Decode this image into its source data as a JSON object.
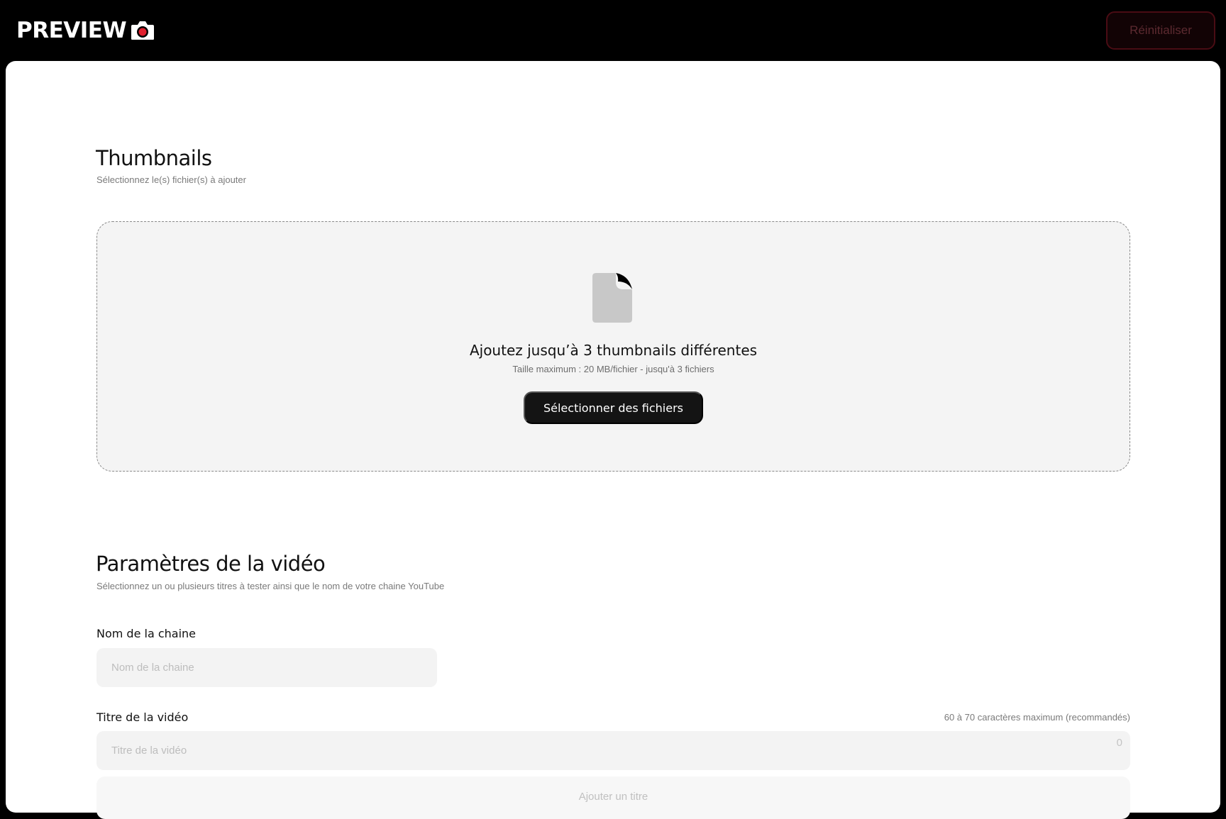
{
  "header": {
    "logo_text": "PREVIEW",
    "logo_icon": "camera-icon",
    "reset_label": "Réinitialiser",
    "accent_color": "#e0202e"
  },
  "thumbnails": {
    "title": "Thumbnails",
    "subtitle": "Sélectionnez le(s) fichier(s) à ajouter",
    "dropzone": {
      "icon": "file-icon",
      "title": "Ajoutez jusqu’à 3 thumbnails différentes",
      "subtitle": "Taille maximum : 20 MB/fichier - jusqu'à 3 fichiers",
      "button_label": "Sélectionner des fichiers"
    }
  },
  "video_settings": {
    "title": "Paramètres de la vidéo",
    "subtitle": "Sélectionnez un ou plusieurs titres à tester ainsi que le nom de votre chaine YouTube",
    "channel": {
      "label": "Nom de la chaine",
      "placeholder": "Nom de la chaine",
      "value": ""
    },
    "video_title": {
      "label": "Titre de la vidéo",
      "hint": "60 à 70 caractères maximum (recommandés)",
      "placeholder": "Titre de la vidéo",
      "value": "",
      "char_count": "0"
    },
    "add_title_label": "Ajouter un titre"
  }
}
